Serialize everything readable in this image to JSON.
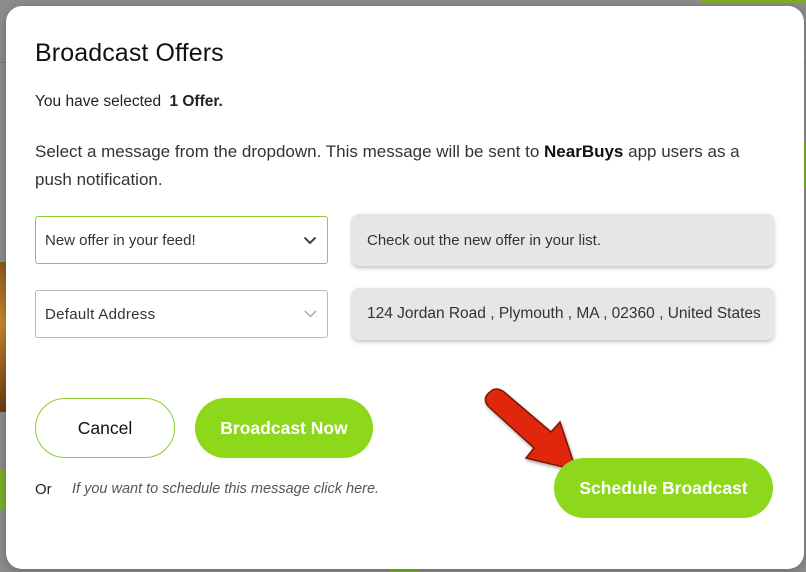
{
  "modal": {
    "title": "Broadcast Offers",
    "selected_prefix": "You have selected",
    "selected_count": "1 Offer.",
    "description_before": "Select a message from the dropdown. This message will be sent to",
    "description_brand": "NearBuys",
    "description_after": "app users as a push notification."
  },
  "message_select": {
    "value": "New offer in your feed!",
    "icon": "chevron-down-icon"
  },
  "message_preview": "Check out the new offer in your list.",
  "address_select": {
    "value": "Default Address",
    "icon": "chevron-down-icon"
  },
  "address_preview": "124 Jordan Road , Plymouth , MA , 02360 , United States",
  "actions": {
    "cancel_label": "Cancel",
    "broadcast_now_label": "Broadcast Now",
    "or_label": "Or",
    "schedule_hint": "If you want to schedule this message click here.",
    "schedule_label": "Schedule Broadcast"
  },
  "colors": {
    "accent": "#8ed81c",
    "annotation_arrow": "#e0280c"
  }
}
